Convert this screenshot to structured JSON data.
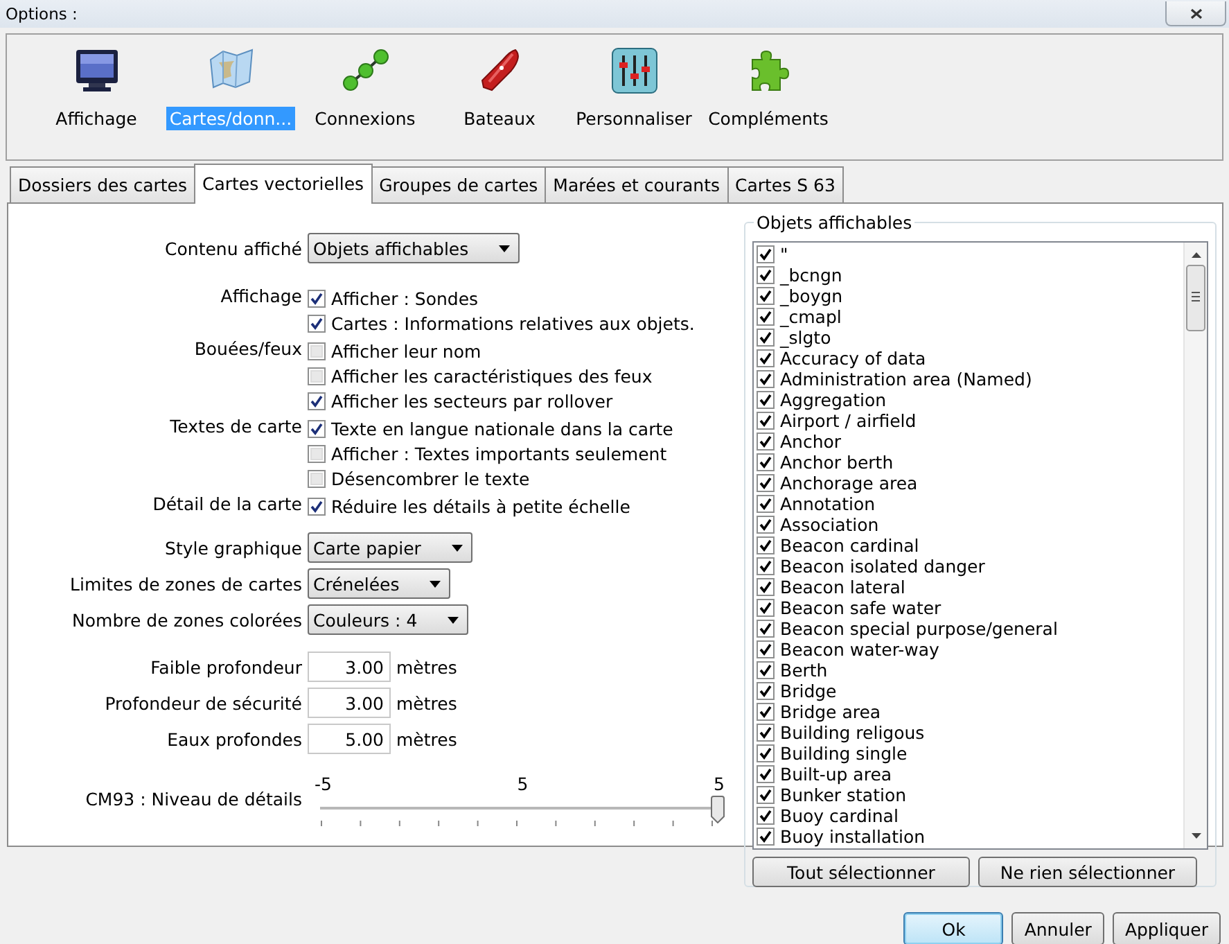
{
  "window": {
    "title": "Options :"
  },
  "toolbar": [
    {
      "label": "Affichage",
      "kind": "monitor",
      "selected": false
    },
    {
      "label": "Cartes/donn...",
      "kind": "charts",
      "selected": true
    },
    {
      "label": "Connexions",
      "kind": "connections",
      "selected": false
    },
    {
      "label": "Bateaux",
      "kind": "boat",
      "selected": false
    },
    {
      "label": "Personnaliser",
      "kind": "sliders",
      "selected": false
    },
    {
      "label": "Compléments",
      "kind": "puzzle",
      "selected": false
    }
  ],
  "tabs": [
    {
      "label": "Dossiers des cartes",
      "selected": false
    },
    {
      "label": "Cartes vectorielles",
      "selected": true
    },
    {
      "label": "Groupes de cartes",
      "selected": false
    },
    {
      "label": "Marées et courants",
      "selected": false
    },
    {
      "label": "Cartes S 63",
      "selected": false
    }
  ],
  "display_settings": {
    "content": {
      "label": "Contenu affiché",
      "value": "Objets affichables"
    },
    "groups": [
      {
        "label": "Affichage",
        "options": [
          {
            "label": "Afficher : Sondes",
            "checked": true
          },
          {
            "label": "Cartes : Informations relatives aux objets.",
            "checked": true
          }
        ]
      },
      {
        "label": "Bouées/feux",
        "options": [
          {
            "label": "Afficher leur nom",
            "checked": false
          },
          {
            "label": "Afficher les caractéristiques des feux",
            "checked": false
          },
          {
            "label": "Afficher les secteurs par rollover",
            "checked": true
          }
        ]
      },
      {
        "label": "Textes de carte",
        "options": [
          {
            "label": "Texte en langue nationale dans la carte",
            "checked": true
          },
          {
            "label": "Afficher : Textes importants seulement",
            "checked": false
          },
          {
            "label": "Désencombrer le texte",
            "checked": false
          }
        ]
      },
      {
        "label": "Détail de la carte",
        "options": [
          {
            "label": "Réduire les détails à petite échelle",
            "checked": true
          }
        ]
      }
    ],
    "styles": [
      {
        "label": "Style graphique",
        "value": "Carte papier"
      },
      {
        "label": "Limites de zones de cartes",
        "value": "Crénelées"
      },
      {
        "label": "Nombre de zones colorées",
        "value": "Couleurs : 4"
      }
    ],
    "depths": [
      {
        "label": "Faible profondeur",
        "value": "3.00",
        "unit": "mètres"
      },
      {
        "label": "Profondeur de sécurité",
        "value": "3.00",
        "unit": "mètres"
      },
      {
        "label": "Eaux profondes",
        "value": "5.00",
        "unit": "mètres"
      }
    ],
    "detail_slider": {
      "label": "CM93 : Niveau de détails",
      "scale": [
        "-5",
        "5",
        "5"
      ],
      "level": 1
    }
  },
  "objects": {
    "title": "Objets affichables",
    "items": [
      {
        "label": "\"",
        "checked": true
      },
      {
        "label": "_bcngn",
        "checked": true
      },
      {
        "label": "_boygn",
        "checked": true
      },
      {
        "label": "_cmapl",
        "checked": true
      },
      {
        "label": "_slgto",
        "checked": true
      },
      {
        "label": "Accuracy of data",
        "checked": true
      },
      {
        "label": "Administration area (Named)",
        "checked": true
      },
      {
        "label": "Aggregation",
        "checked": true
      },
      {
        "label": "Airport / airfield",
        "checked": true
      },
      {
        "label": "Anchor",
        "checked": true
      },
      {
        "label": "Anchor berth",
        "checked": true
      },
      {
        "label": "Anchorage area",
        "checked": true
      },
      {
        "label": "Annotation",
        "checked": true
      },
      {
        "label": "Association",
        "checked": true
      },
      {
        "label": "Beacon cardinal",
        "checked": true
      },
      {
        "label": "Beacon isolated danger",
        "checked": true
      },
      {
        "label": "Beacon lateral",
        "checked": true
      },
      {
        "label": "Beacon safe water",
        "checked": true
      },
      {
        "label": "Beacon special purpose/general",
        "checked": true
      },
      {
        "label": "Beacon water-way",
        "checked": true
      },
      {
        "label": "Berth",
        "checked": true
      },
      {
        "label": "Bridge",
        "checked": true
      },
      {
        "label": "Bridge area",
        "checked": true
      },
      {
        "label": "Building religous",
        "checked": true
      },
      {
        "label": "Building single",
        "checked": true
      },
      {
        "label": "Built-up area",
        "checked": true
      },
      {
        "label": "Bunker station",
        "checked": true
      },
      {
        "label": "Buoy cardinal",
        "checked": true
      },
      {
        "label": "Buoy installation",
        "checked": true
      }
    ],
    "buttons": [
      "Tout sélectionner",
      "Ne rien sélectionner"
    ]
  },
  "buttons": [
    {
      "label": "Ok",
      "focused": true
    },
    {
      "label": "Annuler",
      "focused": false
    },
    {
      "label": "Appliquer",
      "focused": false
    }
  ]
}
